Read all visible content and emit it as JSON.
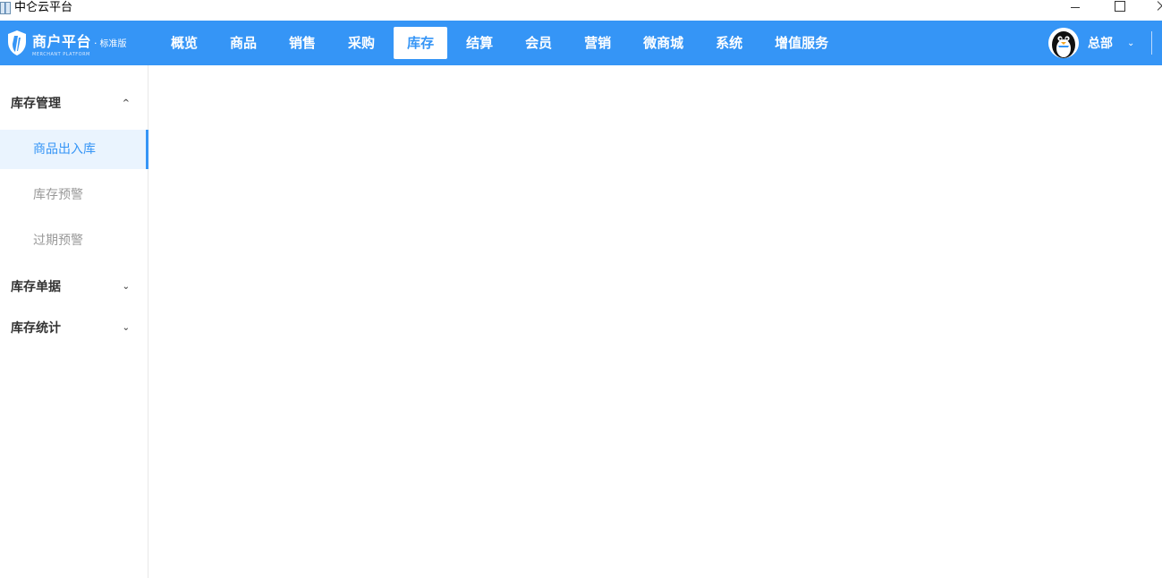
{
  "window": {
    "title": "中仑云平台"
  },
  "logo": {
    "name": "商户平台",
    "separator": "·",
    "edition": "标准版",
    "subtitle": "MERCHANT PLATFORM"
  },
  "nav": {
    "items": [
      {
        "label": "概览"
      },
      {
        "label": "商品"
      },
      {
        "label": "销售"
      },
      {
        "label": "采购"
      },
      {
        "label": "库存"
      },
      {
        "label": "结算"
      },
      {
        "label": "会员"
      },
      {
        "label": "营销"
      },
      {
        "label": "微商城"
      },
      {
        "label": "系统"
      },
      {
        "label": "增值服务"
      }
    ],
    "active": "库存"
  },
  "user": {
    "name": "总部",
    "caret": "⌄"
  },
  "sidebar": {
    "groups": [
      {
        "label": "库存管理",
        "caret": "^",
        "items": [
          {
            "label": "商品出入库"
          },
          {
            "label": "库存预警"
          },
          {
            "label": "过期预警"
          }
        ]
      },
      {
        "label": "库存单据",
        "caret": "⌄"
      },
      {
        "label": "库存统计",
        "caret": "⌄"
      }
    ],
    "active_item": "商品出入库"
  },
  "colors": {
    "primary": "#3595f6",
    "active_bg": "#eaf4fe",
    "muted_text": "#999999"
  }
}
